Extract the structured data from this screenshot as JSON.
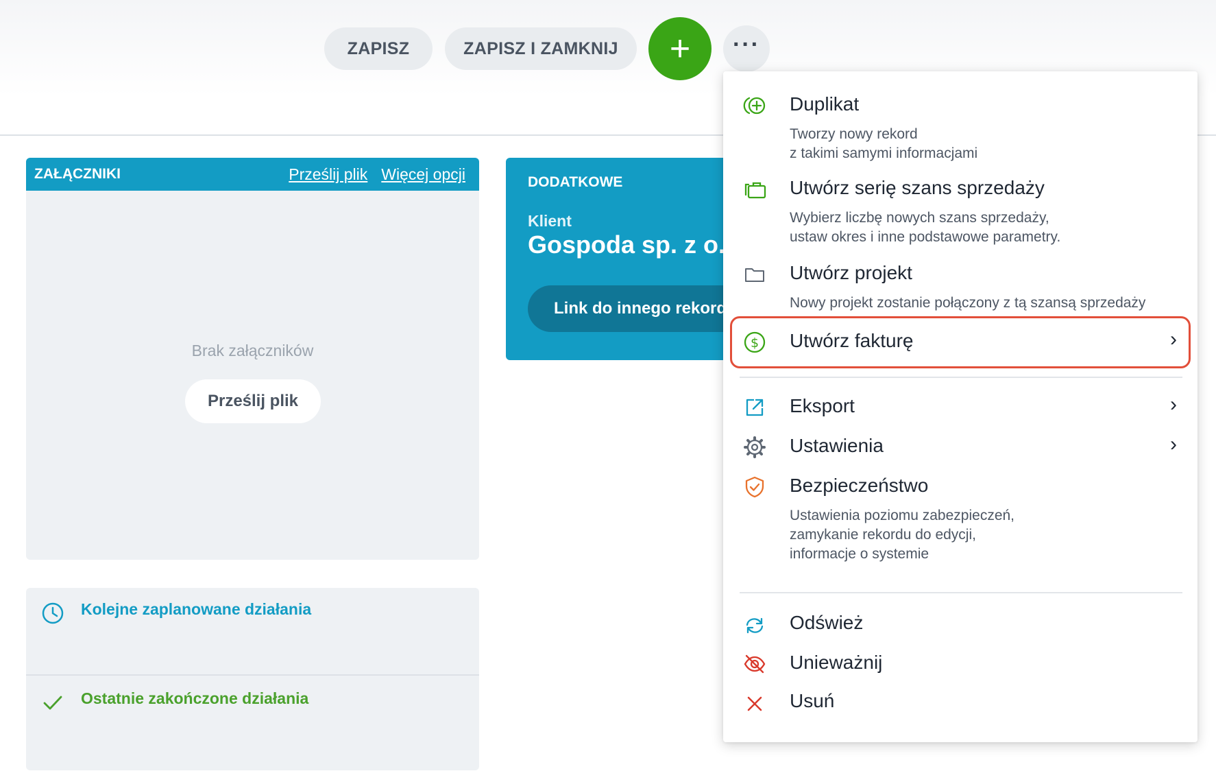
{
  "toolbar": {
    "save_label": "ZAPISZ",
    "save_close_label": "ZAPISZ I ZAMKNIJ",
    "add_label": "+",
    "more_label": "···"
  },
  "attachments": {
    "title": "ZAŁĄCZNIKI",
    "upload_link": "Prześlij plik",
    "more_options_link": "Więcej opcji",
    "empty_text": "Brak załączników",
    "upload_button": "Prześlij plik"
  },
  "activities": {
    "planned_label": "Kolejne zaplanowane działania",
    "done_label": "Ostatnie zakończone działania"
  },
  "additional": {
    "title": "DODATKOWE",
    "client_label": "Klient",
    "client_value": "Gospoda sp. z o...",
    "link_button": "Link do innego rekordu"
  },
  "menu": {
    "duplicate": {
      "title": "Duplikat",
      "desc1": "Tworzy nowy rekord",
      "desc2": "z takimi samymi informacjami"
    },
    "series": {
      "title": "Utwórz serię szans sprzedaży",
      "desc1": "Wybierz liczbę nowych szans sprzedaży,",
      "desc2": "ustaw okres i inne podstawowe parametry."
    },
    "project": {
      "title": "Utwórz projekt",
      "desc1": "Nowy projekt zostanie połączony z tą szansą sprzedaży"
    },
    "invoice": {
      "title": "Utwórz fakturę",
      "chevron": "›"
    },
    "export": {
      "title": "Eksport",
      "chevron": "›"
    },
    "settings": {
      "title": "Ustawienia",
      "chevron": "›"
    },
    "security": {
      "title": "Bezpieczeństwo",
      "desc1": "Ustawienia poziomu zabezpieczeń,",
      "desc2": "zamykanie rekordu do edycji,",
      "desc3": "informacje o systemie"
    },
    "refresh": {
      "title": "Odśwież"
    },
    "invalidate": {
      "title": "Unieważnij"
    },
    "delete": {
      "title": "Usuń"
    }
  },
  "colors": {
    "accent_blue": "#139cc4",
    "accent_green": "#3aa516",
    "highlight_red": "#e24f3a",
    "security_orange": "#e8722c"
  }
}
